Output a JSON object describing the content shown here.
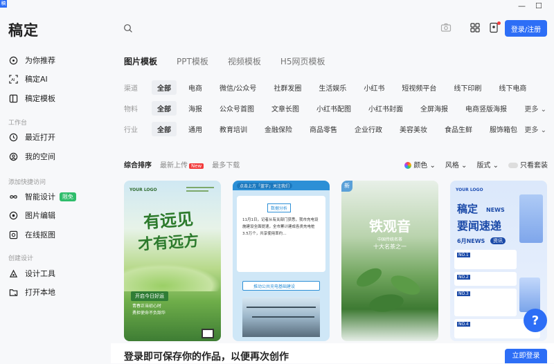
{
  "app": {
    "logo": "稿定",
    "icon_text": "稿"
  },
  "sidebar": {
    "items_top": [
      {
        "label": "为你推荐",
        "icon": "compass-icon"
      },
      {
        "label": "稿定AI",
        "icon": "ai-scan-icon"
      },
      {
        "label": "稿定模板",
        "icon": "template-icon"
      }
    ],
    "section_workbench": "工作台",
    "items_workbench": [
      {
        "label": "最近打开",
        "icon": "clock-icon"
      },
      {
        "label": "我的空间",
        "icon": "space-icon"
      }
    ],
    "section_shortcuts": "添加快捷访问",
    "items_shortcuts": [
      {
        "label": "智能设计",
        "icon": "infinity-icon",
        "badge": "限免"
      },
      {
        "label": "图片编辑",
        "icon": "image-edit-icon"
      },
      {
        "label": "在线抠图",
        "icon": "cutout-icon"
      }
    ],
    "section_create": "创建设计",
    "items_create": [
      {
        "label": "设计工具",
        "icon": "design-tool-icon"
      },
      {
        "label": "打开本地",
        "icon": "folder-open-icon"
      }
    ]
  },
  "header": {
    "login_label": "登录/注册"
  },
  "tabs": [
    "图片模板",
    "PPT模板",
    "视频模板",
    "H5网页模板"
  ],
  "filters": {
    "channel": {
      "label": "渠道",
      "options": [
        "全部",
        "电商",
        "微信/公众号",
        "社群发圈",
        "生活娱乐",
        "小红书",
        "短视频平台",
        "线下印刷",
        "线下电商"
      ]
    },
    "material": {
      "label": "物料",
      "options": [
        "全部",
        "海报",
        "公众号首图",
        "文章长图",
        "小红书配图",
        "小红书封面",
        "全屏海报",
        "电商竖版海报"
      ],
      "more": "更多"
    },
    "industry": {
      "label": "行业",
      "options": [
        "全部",
        "通用",
        "教育培训",
        "金融保险",
        "商品零售",
        "企业行政",
        "美容美妆",
        "食品生鲜",
        "服饰箱包"
      ],
      "more": "更多"
    }
  },
  "sort": {
    "options": [
      "综合排序",
      "最新上传",
      "最多下载"
    ],
    "new_badge": "New",
    "color": "颜色",
    "style": "风格",
    "layout": "版式",
    "only_free": "只看套装"
  },
  "cards": [
    {
      "logo": "YOUR LOGO",
      "title1": "有远见",
      "title2": "才有远方",
      "tag": "开启今日好运",
      "lines": [
        "青春正当初心时",
        "勇担使命不负韶华"
      ]
    },
    {
      "header": "点击上方「蓝字」关注我们",
      "tag": "数据分析",
      "body": "11月1日，记者从有关部门获悉，我市充电设施建设全面提速，全市累计建成各类充电桩3.5万个，共享使用率约…",
      "link": "推动公共充电基础建设"
    },
    {
      "corner": "新",
      "title": "铁观音",
      "sub1": "中国传统名茶",
      "sub2": "十大名茶之一"
    },
    {
      "logo": "YOUR LOGO",
      "title1": "稿定",
      "news": "NEWS",
      "title2": "要闻速递",
      "date": "6月NEWS",
      "pill": "资讯",
      "items": [
        "NO.1",
        "NO.2",
        "NO.3",
        "NO.4"
      ]
    }
  ],
  "help": "?",
  "banner": {
    "text": "登录即可保存你的作品，以便再次创作",
    "button": "立即登录"
  },
  "colors": {
    "accent": "#2d6ef6",
    "badge_green": "#2fbd6b",
    "new_red": "#f23b3b"
  }
}
